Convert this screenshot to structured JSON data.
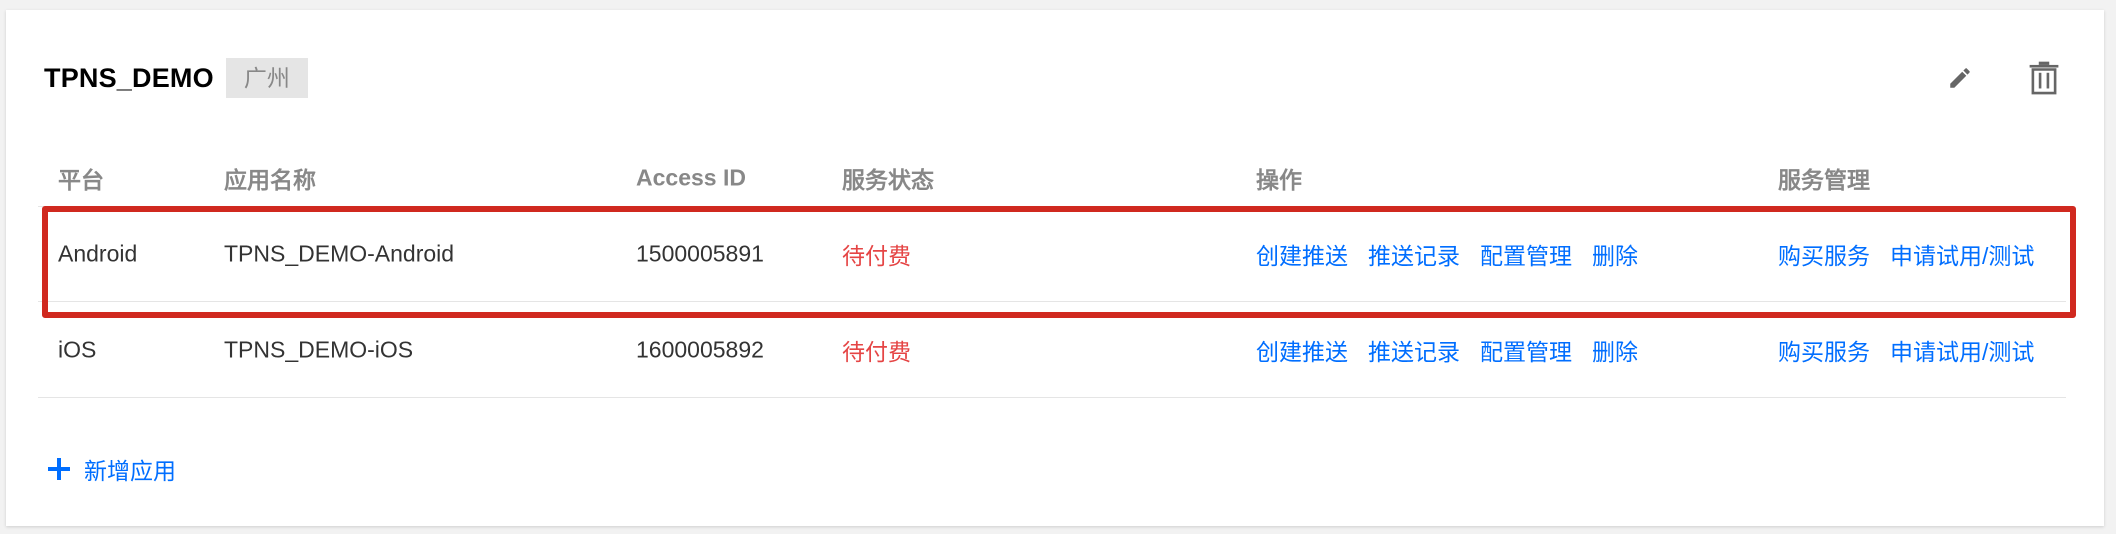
{
  "project": {
    "title": "TPNS_DEMO",
    "region": "广州"
  },
  "table": {
    "headers": {
      "platform": "平台",
      "app_name": "应用名称",
      "access_id": "Access ID",
      "status": "服务状态",
      "ops": "操作",
      "service": "服务管理"
    },
    "rows": [
      {
        "platform": "Android",
        "app_name": "TPNS_DEMO-Android",
        "access_id": "1500005891",
        "status": "待付费",
        "ops": [
          "创建推送",
          "推送记录",
          "配置管理",
          "删除"
        ],
        "service": [
          "购买服务",
          "申请试用/测试"
        ]
      },
      {
        "platform": "iOS",
        "app_name": "TPNS_DEMO-iOS",
        "access_id": "1600005892",
        "status": "待付费",
        "ops": [
          "创建推送",
          "推送记录",
          "配置管理",
          "删除"
        ],
        "service": [
          "购买服务",
          "申请试用/测试"
        ]
      }
    ]
  },
  "add_app_label": "新增应用",
  "colors": {
    "link": "#006eff",
    "status_pending": "#e54545",
    "highlight_border": "#d0291f"
  },
  "icons": {
    "edit": "pencil-icon",
    "delete": "trash-icon",
    "add": "plus-icon"
  }
}
